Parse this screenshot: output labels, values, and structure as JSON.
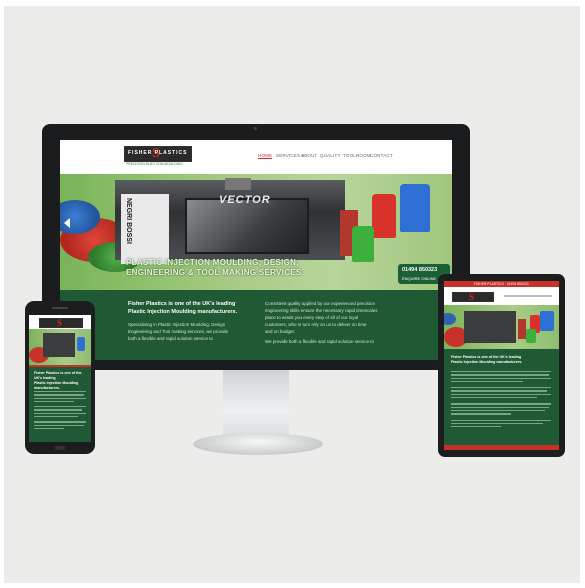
{
  "site": {
    "logo": {
      "name": "FISHER PLASTICS",
      "tagline": "PRECISION INJECTION MOULDING"
    },
    "nav": [
      {
        "label": "HOME",
        "active": true
      },
      {
        "label": "SERVICES ▾",
        "active": false
      },
      {
        "label": "ABOUT",
        "active": false
      },
      {
        "label": "QUALITY",
        "active": false
      },
      {
        "label": "TOOLROOM",
        "active": false
      },
      {
        "label": "CONTACT",
        "active": false
      }
    ],
    "hero": {
      "brand_vertical": "NEGRI BOSSI",
      "brand": "VECTOR",
      "title_line1": "PLASTIC INJECTION MOULDING, DESIGN,",
      "title_line2": "ENGINEERING & TOOL MAKING SERVICES",
      "phone": "01494 850323",
      "email": "ENQUIRE ONLINE"
    },
    "intro": {
      "heading_line1": "Fisher Plastics is one of the UK's leading",
      "heading_line2": "Plastic Injection Moulding manufacturers.",
      "para1_line1": "Specialising in Plastic Injection Moulding, Design",
      "para1_line2": "Engineering and Tool making services, we provide",
      "para1_line3": "both a flexible and rapid solution service to",
      "right_line1": "Consistent quality applied by our experienced precision",
      "right_line2": "engineering skills ensure the necessary rapid timescales",
      "right_line3": "place to assist you every step of all of our loyal",
      "right_line4": "customers, who in turn rely on us to deliver on time",
      "right_line5": "and on budget.",
      "right_line6": "We provide both a flexible and rapid solution service to"
    },
    "tablet_banner": "FISHER PLASTICS · 01494 850323"
  },
  "colors": {
    "brand_green": "#1f5a34",
    "brand_red": "#d92626",
    "panel": "#ececea"
  },
  "icons": [
    "slider-prev-icon",
    "phone-icon"
  ]
}
